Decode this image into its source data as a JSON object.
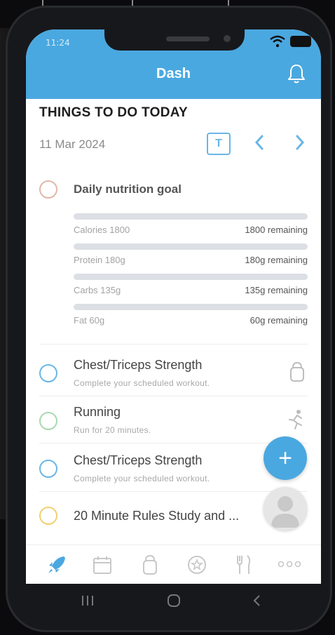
{
  "status": {
    "time": "11:24",
    "battery_text": ""
  },
  "app": {
    "title": "Dash"
  },
  "section": {
    "title": "THINGS TO DO TODAY",
    "date": "11 Mar 2024",
    "today_button": "T"
  },
  "nutrition": {
    "title": "Daily nutrition goal",
    "rows": [
      {
        "label": "Calories 1800",
        "remaining": "1800 remaining",
        "progress": 0
      },
      {
        "label": "Protein 180g",
        "remaining": "180g remaining",
        "progress": 0
      },
      {
        "label": "Carbs 135g",
        "remaining": "135g remaining",
        "progress": 0
      },
      {
        "label": "Fat 60g",
        "remaining": "60g remaining",
        "progress": 0
      }
    ]
  },
  "tasks": [
    {
      "title": "Chest/Triceps Strength",
      "subtitle": "Complete your scheduled workout.",
      "icon": "kettlebell-icon"
    },
    {
      "title": "Running",
      "subtitle": "Run for 20 minutes.",
      "icon": "runner-icon"
    },
    {
      "title": "Chest/Triceps Strength",
      "subtitle": "Complete your scheduled workout.",
      "icon": "kettlebell-icon"
    },
    {
      "title": "20 Minute Rules Study and ...",
      "subtitle": "",
      "icon": ""
    }
  ],
  "fab": {
    "label": "+"
  },
  "tabs": [
    "rocket-icon",
    "calendar-icon",
    "kettlebell-icon",
    "star-badge-icon",
    "utensils-icon",
    "more-icon"
  ],
  "colors": {
    "accent": "#4aa8e0",
    "nutrition_circle": "#e0b8a8",
    "workout_circle": "#6ab6e6",
    "running_circle": "#a8d8b0",
    "study_circle": "#f0d070"
  }
}
